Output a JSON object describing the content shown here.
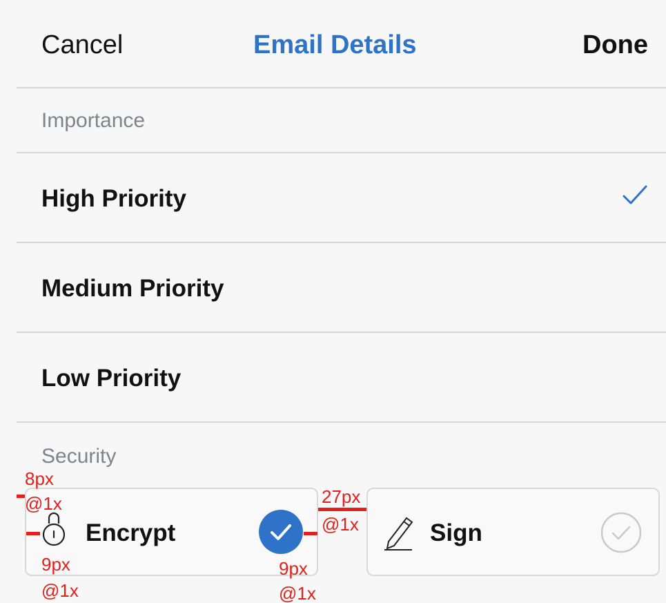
{
  "navbar": {
    "cancel_label": "Cancel",
    "title": "Email Details",
    "done_label": "Done"
  },
  "importance": {
    "header": "Importance",
    "items": [
      {
        "label": "High Priority",
        "selected": true
      },
      {
        "label": "Medium Priority",
        "selected": false
      },
      {
        "label": "Low Priority",
        "selected": false
      }
    ]
  },
  "security": {
    "header": "Security",
    "encrypt": {
      "label": "Encrypt",
      "icon": "lock-icon",
      "checked": true
    },
    "sign": {
      "label": "Sign",
      "icon": "pen-icon",
      "checked": false
    }
  },
  "annotations": {
    "left_margin": {
      "value": "8px",
      "scale": "@1x"
    },
    "icon_padding": {
      "value": "9px",
      "scale": "@1x"
    },
    "check_padding": {
      "value": "9px",
      "scale": "@1x"
    },
    "card_gap": {
      "value": "27px",
      "scale": "@1x"
    }
  },
  "colors": {
    "accent": "#2f73c8",
    "annotation": "#e3201b",
    "divider": "#d6d6d6",
    "section_header": "#7d848c"
  }
}
